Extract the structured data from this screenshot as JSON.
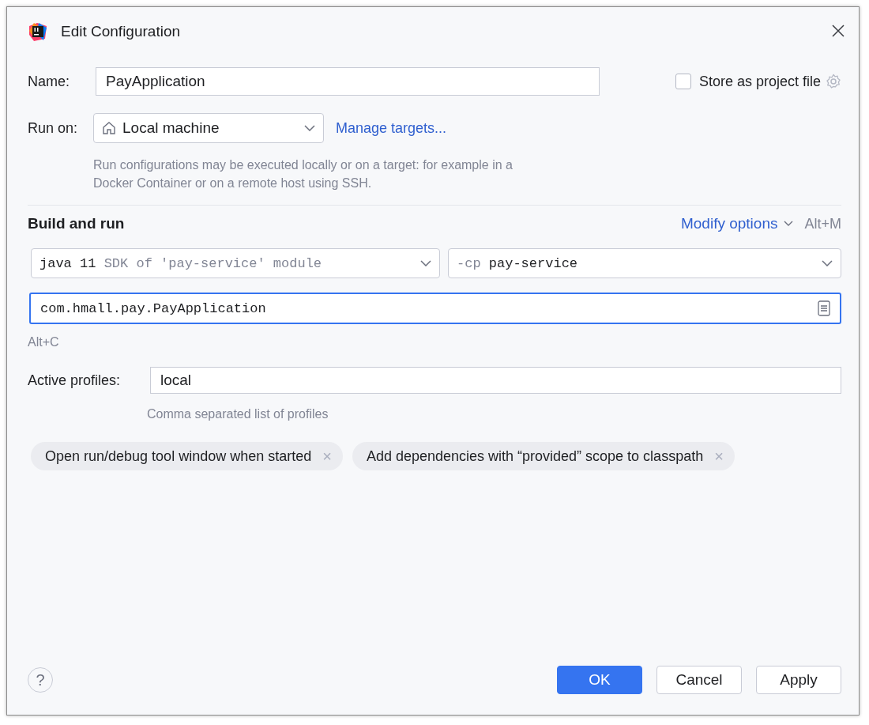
{
  "window": {
    "title": "Edit Configuration"
  },
  "name_field": {
    "label": "Name:",
    "value": "PayApplication"
  },
  "store_as_project_file": {
    "label": "Store as project file",
    "checked": false
  },
  "run_on": {
    "label": "Run on:",
    "value": "Local machine",
    "link": "Manage targets...",
    "hint": "Run configurations may be executed locally or on a target: for example in a Docker Container or on a remote host using SSH."
  },
  "build_and_run": {
    "title": "Build and run",
    "modify_options": "Modify options",
    "shortcut": "Alt+M",
    "sdk": {
      "value": "java 11",
      "detail": "SDK of 'pay-service' module"
    },
    "classpath": {
      "prefix": "-cp",
      "value": "pay-service"
    },
    "main_class": {
      "value": "com.hmall.pay.PayApplication",
      "focused": true
    },
    "main_class_shortcut": "Alt+C"
  },
  "active_profiles": {
    "label": "Active profiles:",
    "value": "local",
    "hint": "Comma separated list of profiles"
  },
  "option_tags": [
    {
      "label": "Open run/debug tool window when started",
      "close": "×"
    },
    {
      "label": "Add dependencies with “provided” scope to classpath",
      "close": "×"
    }
  ],
  "help": "?",
  "buttons": [
    {
      "label": "OK",
      "primary": true
    },
    {
      "label": "Cancel",
      "primary": false
    },
    {
      "label": "Apply",
      "primary": false
    }
  ]
}
